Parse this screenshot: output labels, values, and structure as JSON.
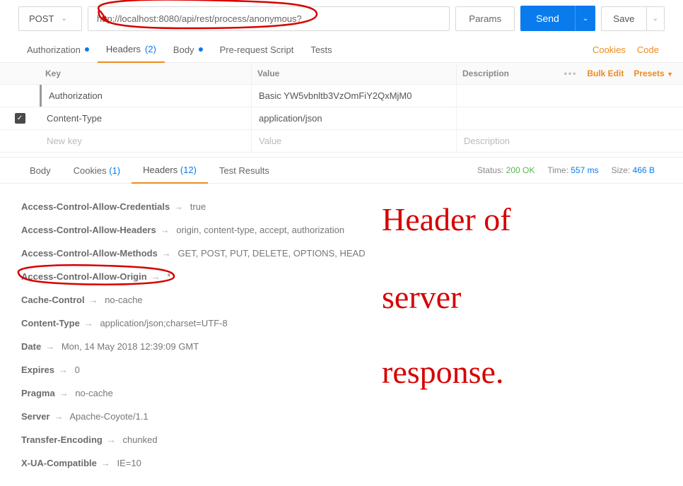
{
  "request": {
    "method": "POST",
    "url": "http://localhost:8080/api/rest/process/anonymous?",
    "params_label": "Params",
    "send_label": "Send",
    "save_label": "Save"
  },
  "req_tabs": {
    "auth": "Authorization",
    "headers": "Headers",
    "headers_count": "(2)",
    "body": "Body",
    "prerequest": "Pre-request Script",
    "tests": "Tests",
    "cookies": "Cookies",
    "code": "Code"
  },
  "hdr_cols": {
    "key": "Key",
    "value": "Value",
    "desc": "Description",
    "bulk": "Bulk Edit",
    "presets": "Presets"
  },
  "hdr_rows": [
    {
      "key": "Authorization",
      "value": "Basic YW5vbnltb3VzOmFiY2QxMjM0",
      "checked": false
    },
    {
      "key": "Content-Type",
      "value": "application/json",
      "checked": true
    }
  ],
  "hdr_ghost": {
    "key": "New key",
    "value": "Value",
    "desc": "Description"
  },
  "resp_tabs": {
    "body": "Body",
    "cookies": "Cookies",
    "cookies_count": "(1)",
    "headers": "Headers",
    "headers_count": "(12)",
    "tests": "Test Results"
  },
  "status": {
    "status_label": "Status:",
    "status_value": "200 OK",
    "time_label": "Time:",
    "time_value": "557 ms",
    "size_label": "Size:",
    "size_value": "466 B"
  },
  "resp_headers": [
    {
      "k": "Access-Control-Allow-Credentials",
      "v": "true"
    },
    {
      "k": "Access-Control-Allow-Headers",
      "v": "origin, content-type, accept, authorization"
    },
    {
      "k": "Access-Control-Allow-Methods",
      "v": "GET, POST, PUT, DELETE, OPTIONS, HEAD"
    },
    {
      "k": "Access-Control-Allow-Origin",
      "v": "*"
    },
    {
      "k": "Cache-Control",
      "v": "no-cache"
    },
    {
      "k": "Content-Type",
      "v": "application/json;charset=UTF-8"
    },
    {
      "k": "Date",
      "v": "Mon, 14 May 2018 12:39:09 GMT"
    },
    {
      "k": "Expires",
      "v": "0"
    },
    {
      "k": "Pragma",
      "v": "no-cache"
    },
    {
      "k": "Server",
      "v": "Apache-Coyote/1.1"
    },
    {
      "k": "Transfer-Encoding",
      "v": "chunked"
    },
    {
      "k": "X-UA-Compatible",
      "v": "IE=10"
    }
  ],
  "annotations": {
    "handwriting": "Header of server response.",
    "circled_url": true,
    "circled_header": "Access-Control-Allow-Origin"
  }
}
